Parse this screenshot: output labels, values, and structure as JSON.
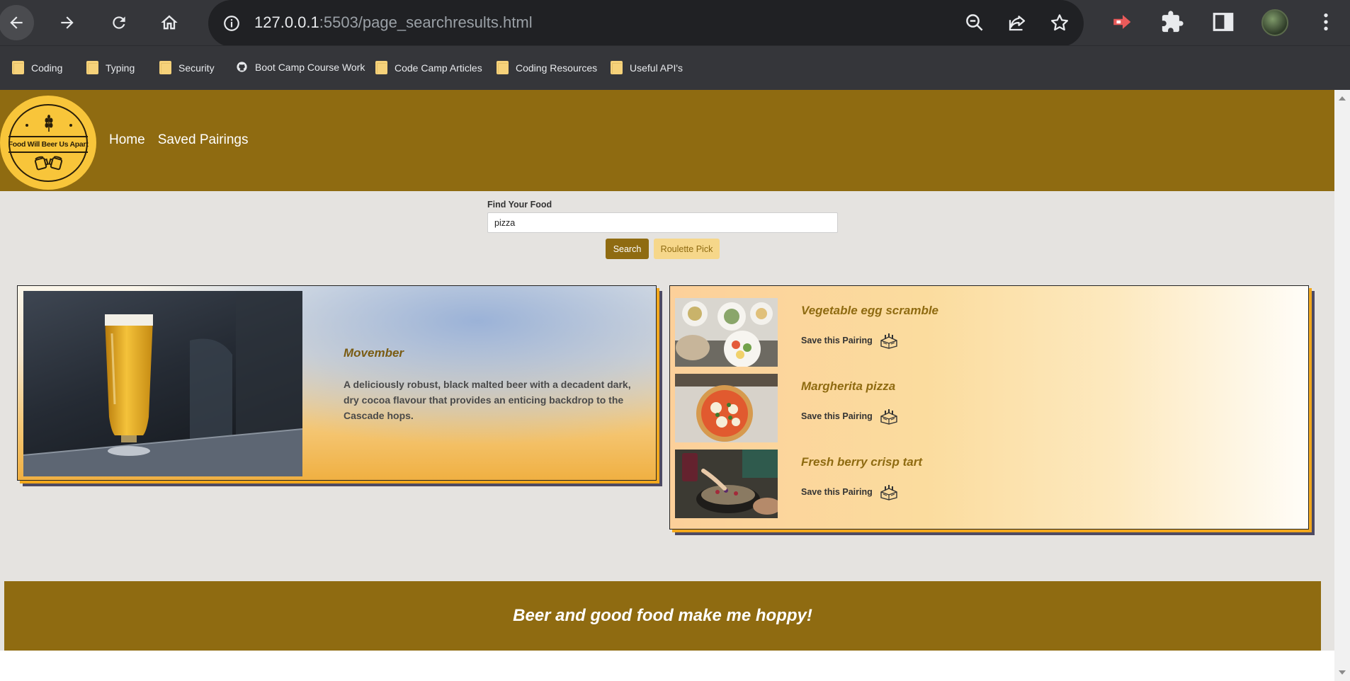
{
  "browser": {
    "url_host": "127.0.0.1",
    "url_rest": ":5503/page_searchresults.html",
    "bookmarks": [
      {
        "label": "Coding",
        "icon": "folder-icon"
      },
      {
        "label": "Typing",
        "icon": "folder-icon"
      },
      {
        "label": "Security",
        "icon": "folder-icon"
      },
      {
        "label": "Boot Camp Course Work",
        "icon": "github-icon"
      },
      {
        "label": "Code Camp Articles",
        "icon": "folder-icon"
      },
      {
        "label": "Coding Resources",
        "icon": "folder-icon"
      },
      {
        "label": "Useful API's",
        "icon": "folder-icon"
      }
    ]
  },
  "site": {
    "logo_text": "Food Will Beer Us Apart",
    "nav": {
      "home": "Home",
      "saved": "Saved Pairings"
    }
  },
  "search": {
    "label": "Find Your Food",
    "value": "pizza",
    "search_button": "Search",
    "roulette_button": "Roulette Pick"
  },
  "beer": {
    "name": "Movember",
    "description": "A deliciously robust, black malted beer with a decadent dark, dry cocoa flavour that provides an enticing backdrop to the Cascade hops."
  },
  "foods": [
    {
      "name": "Vegetable egg scramble",
      "save_label": "Save this Pairing"
    },
    {
      "name": "Margherita pizza",
      "save_label": "Save this Pairing"
    },
    {
      "name": "Fresh berry crisp tart",
      "save_label": "Save this Pairing"
    }
  ],
  "footer": {
    "text": "Beer and good food make me hoppy!"
  },
  "colors": {
    "brand": "#8f6b11",
    "accent": "#f6d78a",
    "logo": "#f8c53a"
  }
}
